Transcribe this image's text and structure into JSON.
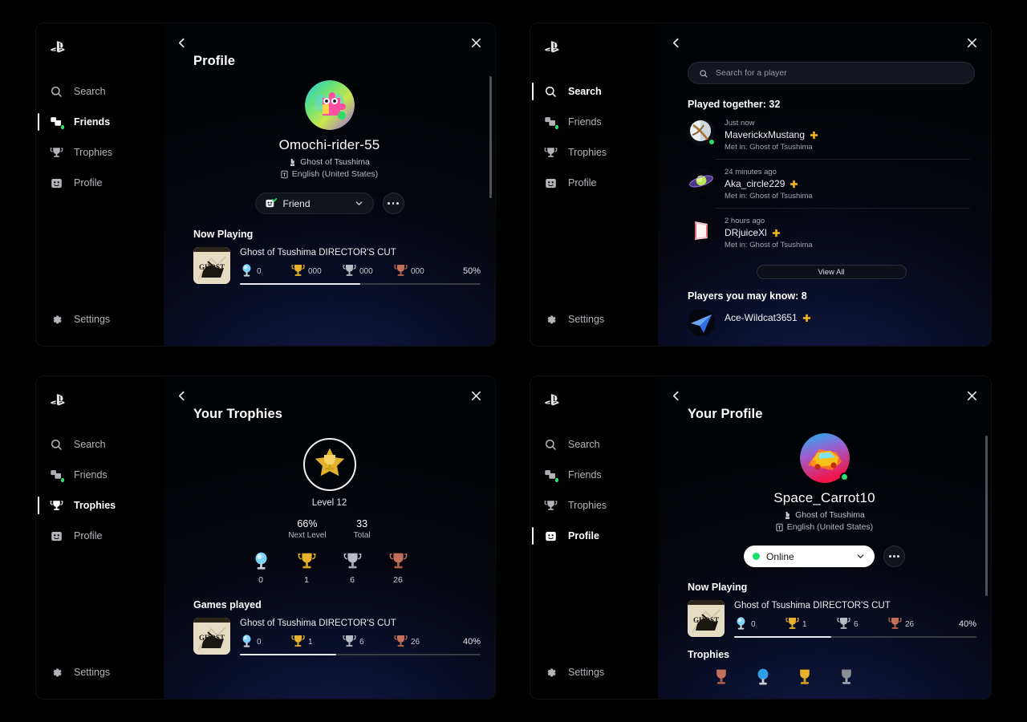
{
  "app": {
    "logo": "playstation-logo"
  },
  "sidebar": {
    "items": [
      {
        "label": "Search",
        "icon": "search-icon"
      },
      {
        "label": "Friends",
        "icon": "friends-icon"
      },
      {
        "label": "Trophies",
        "icon": "trophy-icon"
      },
      {
        "label": "Profile",
        "icon": "profile-icon"
      }
    ],
    "settings": {
      "label": "Settings",
      "icon": "gear-icon"
    }
  },
  "colors": {
    "accent_green": "#2ddf6a",
    "plus_yellow": "#ffc107",
    "progress_fill": "#e9e9ef",
    "panel_bg": "#000000"
  },
  "panel1": {
    "nav_active": "Friends",
    "title": "Profile",
    "back_label": "Back",
    "close_label": "Close",
    "profile": {
      "avatar": "puzzle-character-avatar",
      "name": "Omochi-rider-55",
      "game_line": "Ghost of Tsushima",
      "language_line": "English (United States)",
      "status_label": "Friend",
      "status_icon": "friend-check-icon",
      "more_label": "More options"
    },
    "now_playing": {
      "heading": "Now Playing",
      "game": "Ghost of Tsushima DIRECTOR'S CUT",
      "art": "ghost-of-tsushima-cover",
      "trophies": [
        {
          "type": "platinum",
          "count": "0"
        },
        {
          "type": "gold",
          "count": "000"
        },
        {
          "type": "silver",
          "count": "000"
        },
        {
          "type": "bronze",
          "count": "000"
        }
      ],
      "percent": "50%",
      "progress": 50
    }
  },
  "panel2": {
    "nav_active": "Search",
    "search": {
      "placeholder": "Search for a player",
      "value": "",
      "icon": "search-icon"
    },
    "played_together": {
      "heading": "Played together: 32",
      "players": [
        {
          "time": "Just now",
          "name": "MaverickxMustang",
          "met": "Met in: Ghost of Tsushima",
          "plus": true,
          "online": true,
          "avatar": "sphere-gold-band-avatar"
        },
        {
          "time": "24 minutes ago",
          "name": "Aka_circle229",
          "met": "Met in: Ghost of Tsushima",
          "plus": true,
          "online": false,
          "avatar": "ringed-planet-avatar"
        },
        {
          "time": "2 hours ago",
          "name": "DRjuiceXl",
          "met": "Met in: Ghost of Tsushima",
          "plus": true,
          "online": false,
          "avatar": "pink-scroll-avatar"
        }
      ],
      "view_all": "View All"
    },
    "may_know": {
      "heading": "Players you may know: 8",
      "players": [
        {
          "name": "Ace-Wildcat3651",
          "plus": true,
          "avatar": "blue-paper-plane-avatar"
        }
      ]
    }
  },
  "panel3": {
    "nav_active": "Trophies",
    "title": "Your Trophies",
    "level": {
      "badge": "gold-star-trophy-badge",
      "label": "Level 12",
      "next_level_value": "66%",
      "next_level_key": "Next Level",
      "total_value": "33",
      "total_key": "Total"
    },
    "trophy_counts": [
      {
        "type": "platinum",
        "count": "0"
      },
      {
        "type": "gold",
        "count": "1"
      },
      {
        "type": "silver",
        "count": "6"
      },
      {
        "type": "bronze",
        "count": "26"
      }
    ],
    "games_played": {
      "heading": "Games played",
      "game": "Ghost of Tsushima DIRECTOR'S CUT",
      "art": "ghost-of-tsushima-cover",
      "trophies": [
        {
          "type": "platinum",
          "count": "0"
        },
        {
          "type": "gold",
          "count": "1"
        },
        {
          "type": "silver",
          "count": "6"
        },
        {
          "type": "bronze",
          "count": "26"
        }
      ],
      "percent": "40%",
      "progress": 40
    }
  },
  "panel4": {
    "nav_active": "Profile",
    "title": "Your Profile",
    "profile": {
      "avatar": "yellow-car-avatar",
      "name": "Space_Carrot10",
      "game_line": "Ghost of Tsushima",
      "language_line": "English (United States)",
      "status_label": "Online",
      "more_label": "More options"
    },
    "now_playing": {
      "heading": "Now Playing",
      "game": "Ghost of Tsushima DIRECTOR'S CUT",
      "art": "ghost-of-tsushima-cover",
      "trophies": [
        {
          "type": "platinum",
          "count": "0"
        },
        {
          "type": "gold",
          "count": "1"
        },
        {
          "type": "silver",
          "count": "6"
        },
        {
          "type": "bronze",
          "count": "26"
        }
      ],
      "percent": "40%",
      "progress": 40
    },
    "trophies_heading": "Trophies"
  }
}
